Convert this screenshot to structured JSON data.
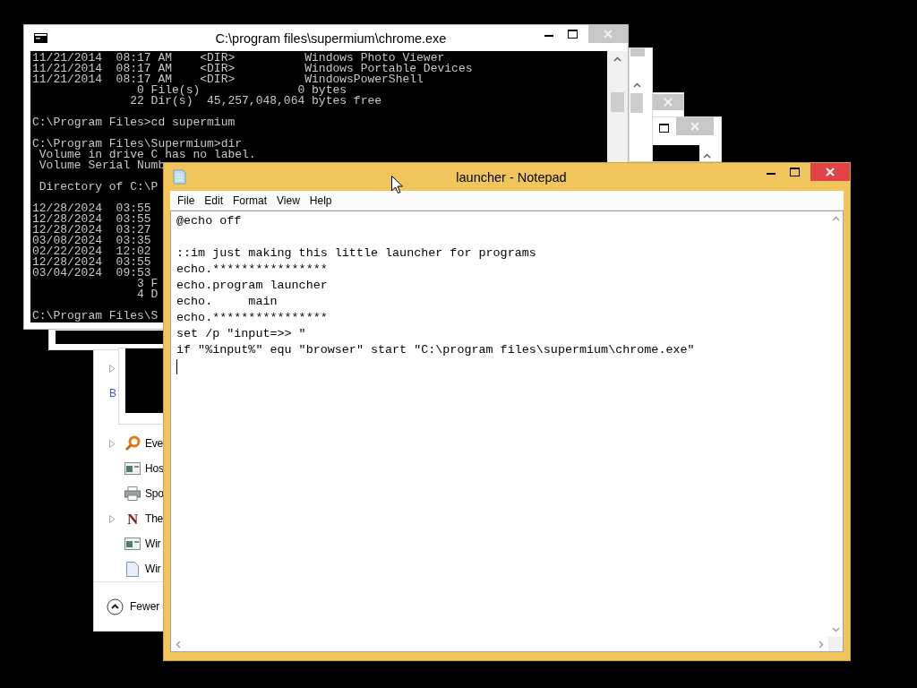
{
  "background_window": {
    "rows": [
      {
        "expandable": true,
        "kind": "none"
      },
      {
        "label": "B",
        "expandable": false,
        "kind": "none"
      },
      {
        "label": "Eve",
        "expandable": true,
        "kind": "key"
      },
      {
        "label": "Hos",
        "expandable": false,
        "kind": "window"
      },
      {
        "label": "Spo",
        "expandable": false,
        "kind": "printer"
      },
      {
        "label": "The",
        "expandable": true,
        "kind": "glyph",
        "glyph": "N"
      },
      {
        "label": "Wir",
        "expandable": false,
        "kind": "window"
      },
      {
        "label": "Wir",
        "expandable": false,
        "kind": "page"
      }
    ],
    "footer_button": "Fewer"
  },
  "console_window": {
    "title": "C:\\program files\\supermium\\chrome.exe",
    "active": false,
    "lines": [
      {
        "text": "11/21/2014  08:17 AM    <DIR>          Windows Photo Viewer"
      },
      {
        "text": "11/21/2014  08:17 AM    <DIR>          Windows Portable Devices"
      },
      {
        "text": "11/21/2014  08:17 AM    <DIR>          WindowsPowerShell"
      },
      {
        "text": "               0 File(s)              0 bytes"
      },
      {
        "text": "              22 Dir(s)  45,257,048,064 bytes free"
      },
      {
        "text": "C:\\Program Files>cd supermium",
        "blank_before": true
      },
      {
        "text": "C:\\Program Files\\Supermium>dir",
        "blank_before": true
      },
      {
        "text": " Volume in drive C has no label."
      },
      {
        "text": " Volume Serial Numb"
      },
      {
        "text": " Directory of C:\\P",
        "blank_before": true
      },
      {
        "text": "12/28/2024  03:55",
        "blank_before": true
      },
      {
        "text": "12/28/2024  03:55"
      },
      {
        "text": "12/28/2024  03:27"
      },
      {
        "text": "03/08/2024  03:35"
      },
      {
        "text": "02/22/2024  12:02"
      },
      {
        "text": "12/28/2024  03:55"
      },
      {
        "text": "03/04/2024  09:53"
      },
      {
        "text": "               3 F"
      },
      {
        "text": "               4 D"
      },
      {
        "text": "C:\\Program Files\\S",
        "blank_before": true
      }
    ]
  },
  "notepad_window": {
    "title": "launcher - Notepad",
    "active": true,
    "menu": [
      "File",
      "Edit",
      "Format",
      "View",
      "Help"
    ],
    "lines": [
      {
        "text": "@echo off"
      },
      {
        "text": "::im just making this little launcher for programs",
        "blank_before": true
      },
      {
        "text": "echo.****************"
      },
      {
        "text": "echo.program launcher"
      },
      {
        "text": "echo.     main"
      },
      {
        "text": "echo.****************"
      },
      {
        "text": "set /p \"input=>> \""
      },
      {
        "text": "if \"%input%\" equ \"browser\" start \"C:\\program files\\supermium\\chrome.exe\""
      }
    ]
  }
}
